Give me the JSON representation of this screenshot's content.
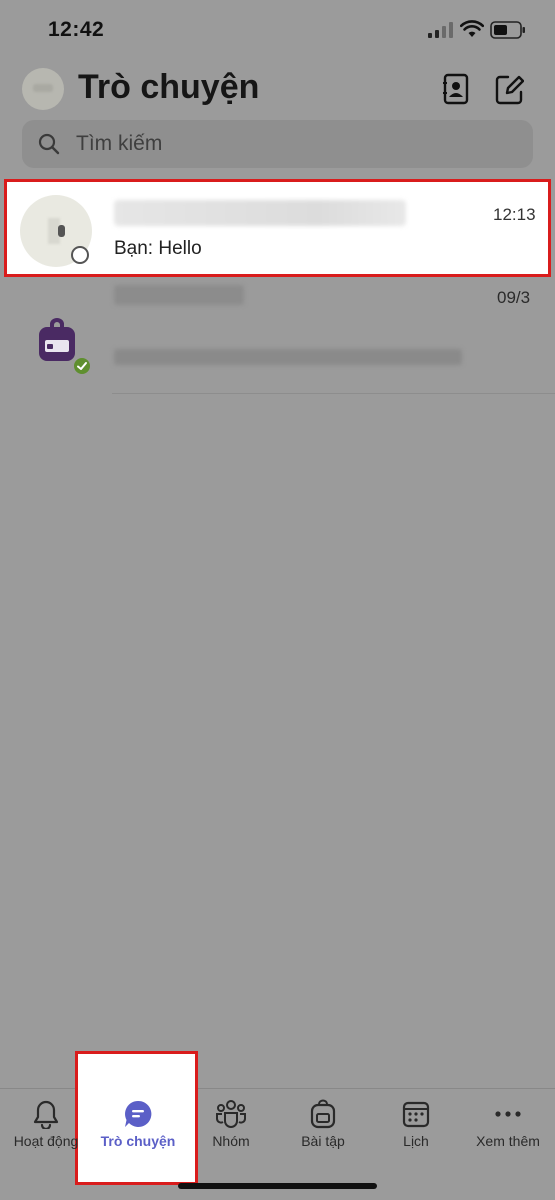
{
  "status_bar": {
    "time": "12:42"
  },
  "header": {
    "title": "Trò chuyện"
  },
  "search": {
    "placeholder": "Tìm kiếm"
  },
  "chats": [
    {
      "time": "12:13",
      "preview": "Bạn: Hello",
      "presence": "offline"
    },
    {
      "time": "09/3",
      "presence": "online"
    }
  ],
  "tabs": [
    {
      "label": "Hoạt động",
      "icon": "bell-icon"
    },
    {
      "label": "Trò chuyện",
      "icon": "chat-icon"
    },
    {
      "label": "Nhóm",
      "icon": "teams-icon"
    },
    {
      "label": "Bài tập",
      "icon": "backpack-icon"
    },
    {
      "label": "Lịch",
      "icon": "calendar-icon"
    },
    {
      "label": "Xem thêm",
      "icon": "more-icon"
    }
  ],
  "colors": {
    "accent": "#5b5fc7",
    "highlight_border": "#d91c1c",
    "online": "#5f8f2f",
    "overlay": "#9b9b9b"
  }
}
